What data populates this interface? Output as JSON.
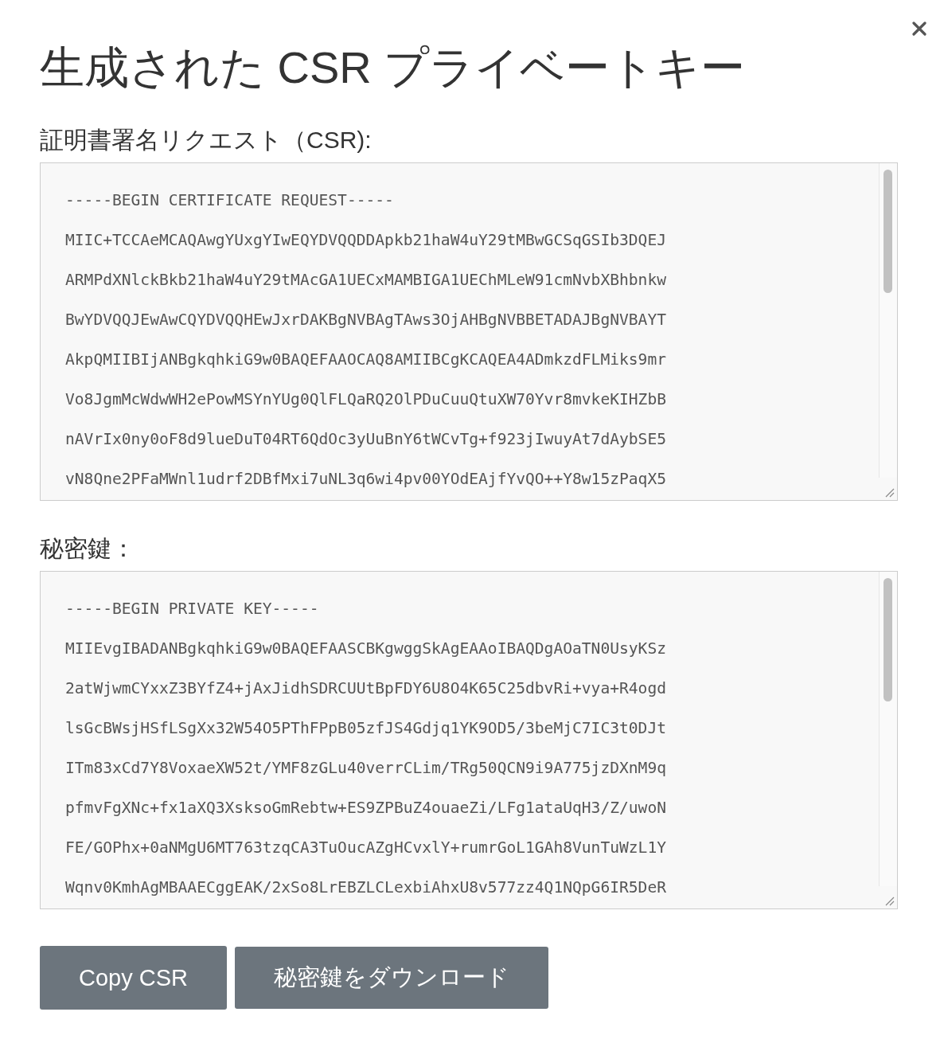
{
  "dialog": {
    "title": "生成された CSR プライベートキー"
  },
  "sections": [
    {
      "kind": "csr",
      "label": "証明書署名リクエスト（CSR):",
      "lines": [
        "-----BEGIN CERTIFICATE REQUEST-----",
        "MIIC+TCCAeMCAQAwgYUxgYIwEQYDVQQDDApkb21haW4uY29tMBwGCSqGSIb3DQEJ",
        "ARMPdXNlckBkb21haW4uY29tMAcGA1UECxMAMBIGA1UEChMLeW91cmNvbXBhbnkw",
        "BwYDVQQJEwAwCQYDVQQHEwJxrDAKBgNVBAgTAws3OjAHBgNVBBETADAJBgNVBAYT",
        "AkpQMIIBIjANBgkqhkiG9w0BAQEFAAOCAQ8AMIIBCgKCAQEA4ADmkzdFLMiks9mr",
        "Vo8JgmMcWdwWH2ePowMSYnYUg0QlFLQaRQ2OlPDuCuuQtuXW70Yvr8mvkeKIHZbB",
        "nAVrIx0ny0oF8d9lueDuT04RT6QdOc3yUuBnY6tWCvTg+f923jIwuyAt7dAybSE5",
        "vN8Qne2PFaMWnl1udrf2DBfMxi7uNL3q6wi4pv00YOdEAjfYvQO++Y8w15zPaqX5"
      ]
    },
    {
      "kind": "key",
      "label": "秘密鍵：",
      "lines": [
        "-----BEGIN PRIVATE KEY-----",
        "MIIEvgIBADANBgkqhkiG9w0BAQEFAASCBKgwggSkAgEAAoIBAQDgAOaTN0UsyKSz",
        "2atWjwmCYxxZ3BYfZ4+jAxJidhSDRCUUtBpFDY6U8O4K65C25dbvRi+vya+R4ogd",
        "lsGcBWsjHSfLSgXx32W54O5PThFPpB05zfJS4Gdjq1YK9OD5/3beMjC7IC3t0DJt",
        "ITm83xCd7Y8VoxaeXW52t/YMF8zGLu40verrCLim/TRg50QCN9i9A775jzDXnM9q",
        "pfmvFgXNc+fx1aXQ3XsksoGmRebtw+ES9ZPBuZ4ouaeZi/LFg1ataUqH3/Z/uwoN",
        "FE/GOPhx+0aNMgU6MT763tzqCA3TuOucAZgHCvxlY+rumrGoL1GAh8VunTuWzL1Y",
        "Wqnv0KmhAgMBAAECggEAK/2xSo8LrEBZLCLexbiAhxU8v577zz4Q1NQpG6IR5DeR"
      ]
    }
  ],
  "buttons": [
    {
      "kind": "copy",
      "label": "Copy CSR"
    },
    {
      "kind": "download",
      "label": "秘密鍵をダウンロード"
    }
  ]
}
